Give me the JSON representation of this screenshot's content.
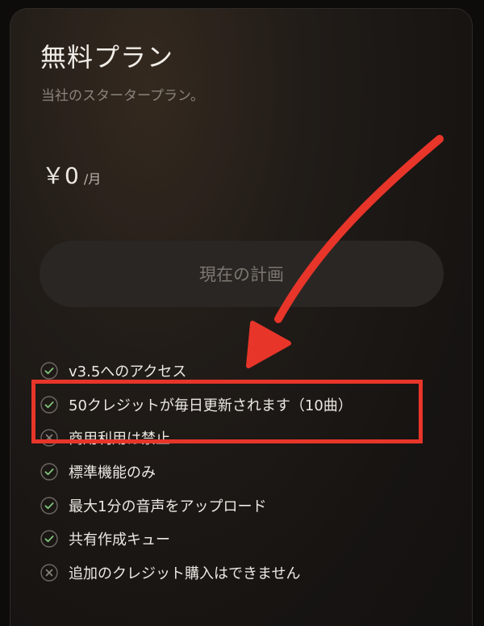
{
  "plan": {
    "title": "無料プラン",
    "subtitle": "当社のスタータープラン。",
    "price": "￥0",
    "price_unit": "/月",
    "current_plan_button": "現在の計画"
  },
  "features": [
    {
      "text": "v3.5へのアクセス",
      "included": true
    },
    {
      "text": "50クレジットが毎日更新されます（10曲）",
      "included": true
    },
    {
      "text": "商用利用は禁止",
      "included": false
    },
    {
      "text": "標準機能のみ",
      "included": true
    },
    {
      "text": "最大1分の音声をアップロード",
      "included": true
    },
    {
      "text": "共有作成キュー",
      "included": true
    },
    {
      "text": "追加のクレジット購入はできません",
      "included": false
    }
  ],
  "icons": {
    "included": "check-circle-icon",
    "excluded": "x-circle-icon"
  },
  "colors": {
    "annotation": "#e8352a",
    "check": "#7fc47a",
    "muted": "#8b847d"
  }
}
